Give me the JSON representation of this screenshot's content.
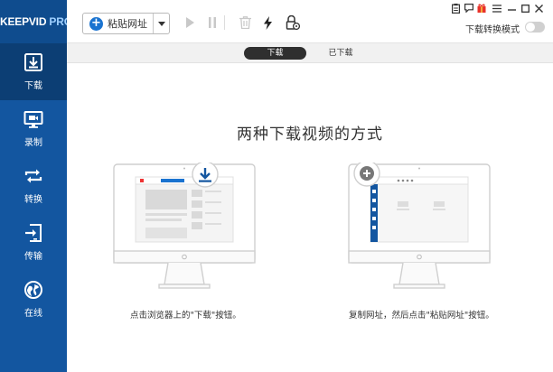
{
  "app": {
    "logo_main": "KEEPVID ",
    "logo_accent": "PRO"
  },
  "sidebar": {
    "items": [
      {
        "label": "下载",
        "icon": "download-icon",
        "active": true
      },
      {
        "label": "录制",
        "icon": "record-monitor-icon",
        "active": false
      },
      {
        "label": "转换",
        "icon": "convert-icon",
        "active": false
      },
      {
        "label": "传输",
        "icon": "transfer-icon",
        "active": false
      },
      {
        "label": "在线",
        "icon": "globe-icon",
        "active": false
      }
    ]
  },
  "toolbar": {
    "paste_label": "粘贴网址",
    "icons": [
      "play-icon",
      "pause-icon",
      "trash-icon",
      "lightning-icon",
      "lock-settings-icon"
    ],
    "mode_label": "下载转换模式",
    "mode_on": false
  },
  "tabs": [
    {
      "label": "下载",
      "active": true
    },
    {
      "label": "已下载",
      "active": false
    }
  ],
  "main": {
    "headline": "两种下载视频的方式",
    "option1_caption": "点击浏览器上的\"下载\"按钮。",
    "option2_caption": "复制网址，然后点击\"粘贴网址\"按钮。"
  },
  "colors": {
    "sidebar": "#1356a0",
    "sidebar_active": "#0c3e74",
    "accent": "#1a73d0"
  }
}
